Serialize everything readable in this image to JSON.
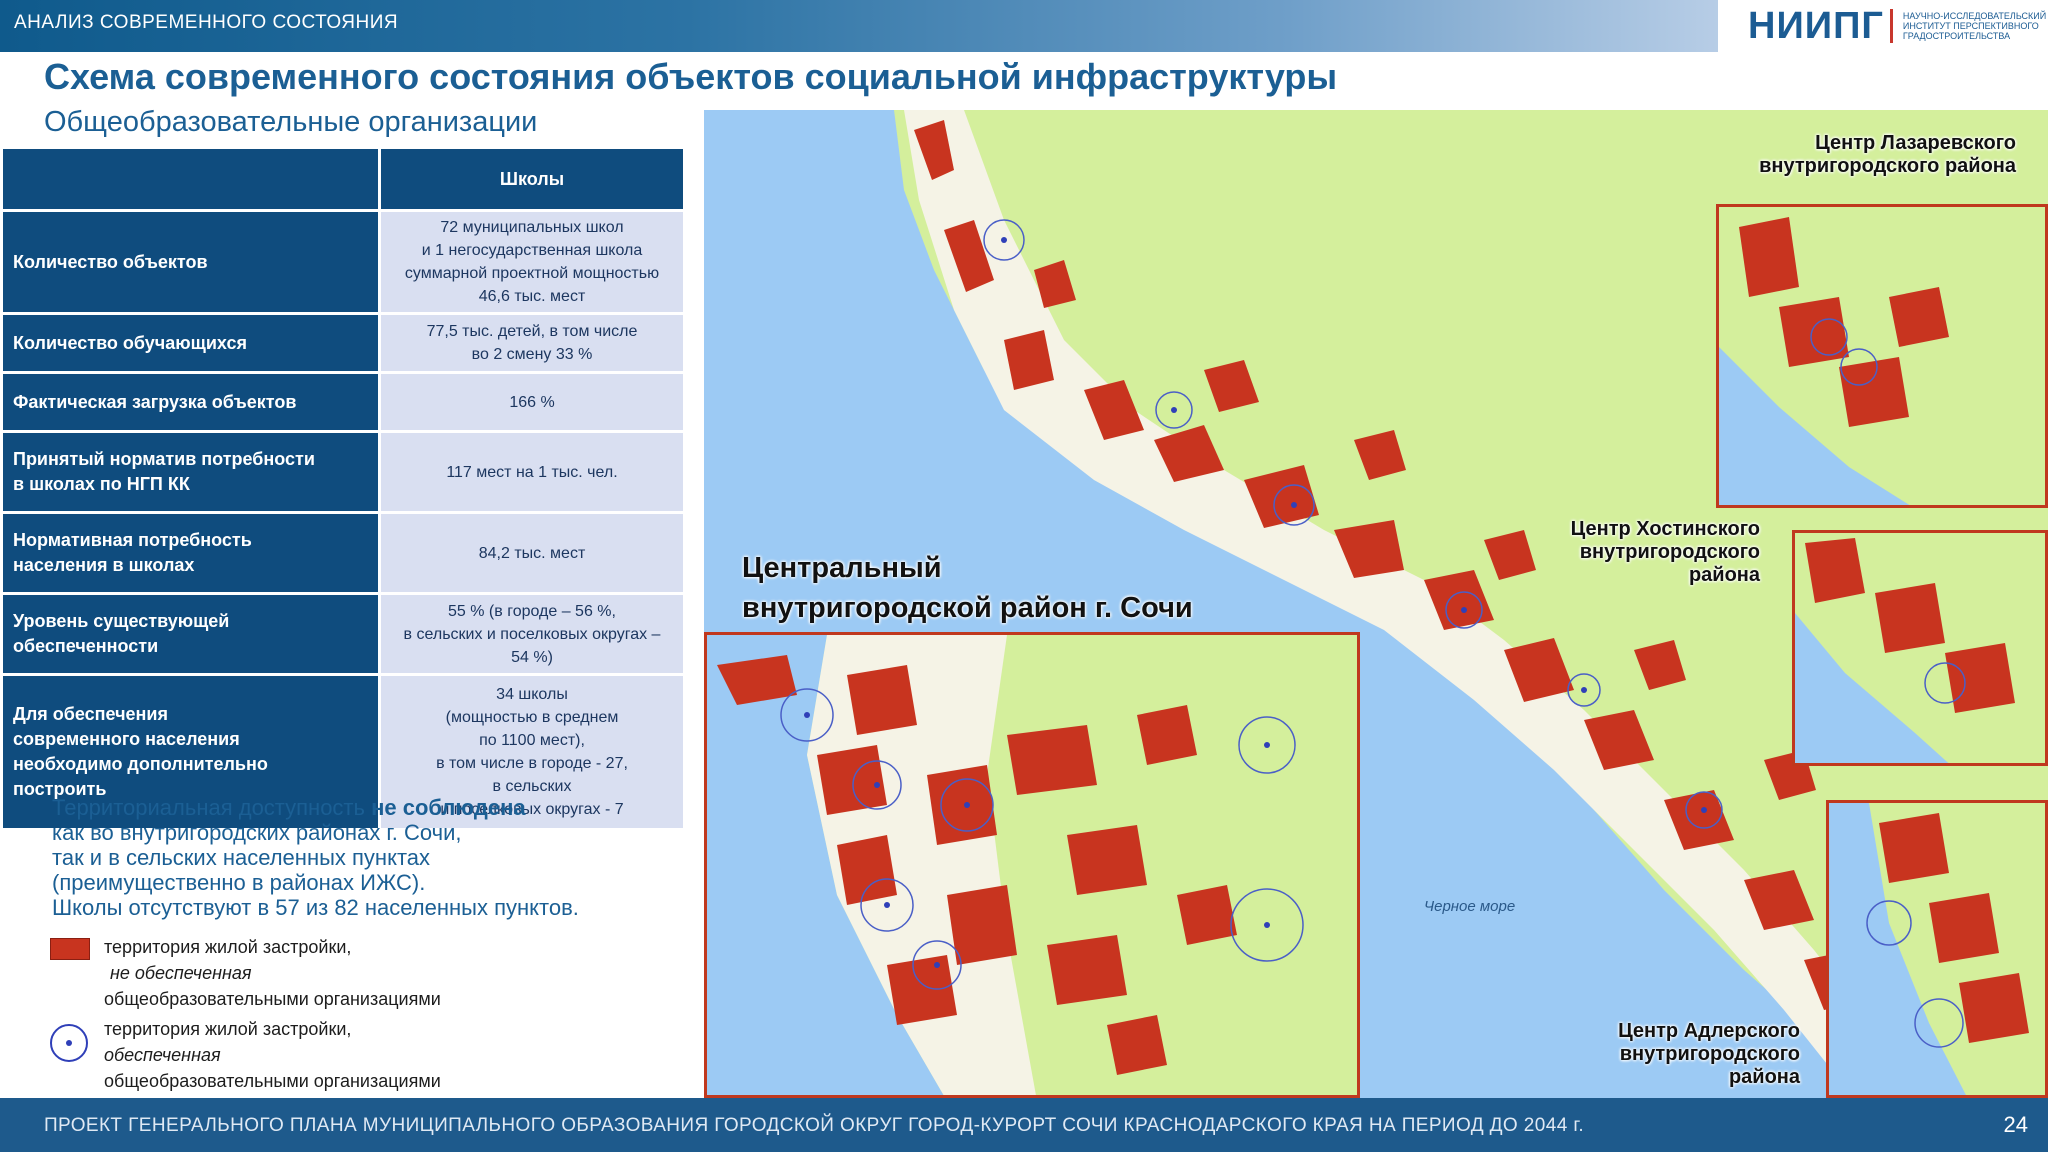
{
  "header": {
    "section": "АНАЛИЗ СОВРЕМЕННОГО СОСТОЯНИЯ",
    "logo_mark": "НИИПГ",
    "logo_sub": "НАУЧНО-ИССЛЕДОВАТЕЛЬСКИЙ ИНСТИТУТ ПЕРСПЕКТИВНОГО ГРАДОСТРОИТЕЛЬСТВА"
  },
  "title": "Схема современного состояния объектов социальной инфраструктуры",
  "subtitle": "Общеобразовательные организации",
  "table": {
    "column_header": "Школы",
    "rows": [
      {
        "label": "Количество объектов",
        "value": "72 муниципальных школ\nи 1 негосударственная школа\nсуммарной проектной мощностью\n46,6 тыс. мест"
      },
      {
        "label": "Количество обучающихся",
        "value": "77,5 тыс. детей, в том числе\nво 2 смену 33 %"
      },
      {
        "label": "Фактическая загрузка объектов",
        "value": "166 %"
      },
      {
        "label": "Принятый норматив потребности\nв школах по НГП КК",
        "value": "117 мест на 1 тыс. чел."
      },
      {
        "label": "Нормативная потребность\nнаселения в школах",
        "value": "84,2 тыс. мест"
      },
      {
        "label": "Уровень существующей\nобеспеченности",
        "value": "55 % (в городе – 56 %,\nв сельских и поселковых округах –\n54 %)"
      },
      {
        "label": "Для обеспечения\nсовременного населения\nнеобходимо дополнительно\nпостроить",
        "value": "34 школы\n(мощностью в среднем\nпо 1100 мест),\nв том числе в городе - 27,\nв сельских\nи поселковых округах - 7"
      }
    ]
  },
  "accessibility": {
    "part1": "Территориальная доступность ",
    "bold": "не соблюдена",
    "part2": "как во внутригородских районах г. Сочи,\nтак и в сельских населенных пунктах\n(преимущественно в районах ИЖС).\nШколы отсутствуют в 57 из 82 населенных пунктов."
  },
  "legend": [
    {
      "line1": "территория жилой застройки,",
      "line2": "не обеспеченная",
      "line3": "общеобразовательными организациями"
    },
    {
      "line1": "территория жилой застройки,",
      "line2": "обеспеченная",
      "line3": "общеобразовательными организациями"
    }
  ],
  "map": {
    "label_lazarevsky": "Центр Лазаревского\nвнутригородского района",
    "label_khostinsky": "Центр Хостинского\nвнутригородского\nрайона",
    "label_central": "Центральный\nвнутригородской район г. Сочи",
    "label_adlersky": "Центр Адлерского\nвнутригородского района",
    "label_sea": "Черное море"
  },
  "footer": {
    "text": "ПРОЕКТ ГЕНЕРАЛЬНОГО ПЛАНА  МУНИЦИПАЛЬНОГО ОБРАЗОВАНИЯ ГОРОДСКОЙ ОКРУГ ГОРОД-КУРОРТ СОЧИ КРАСНОДАРСКОГО КРАЯ НА ПЕРИОД ДО 2044 г.",
    "page": "24"
  },
  "colors": {
    "brand_blue": "#1b5f94",
    "table_header": "#0f4c7e",
    "table_value_bg": "#d9dff1",
    "unserved_red": "#c8341f",
    "served_blue": "#2f3fb8",
    "land_green": "#d4ef9c",
    "sea_blue": "#9ccaf4",
    "inset_border": "#c0381e"
  }
}
